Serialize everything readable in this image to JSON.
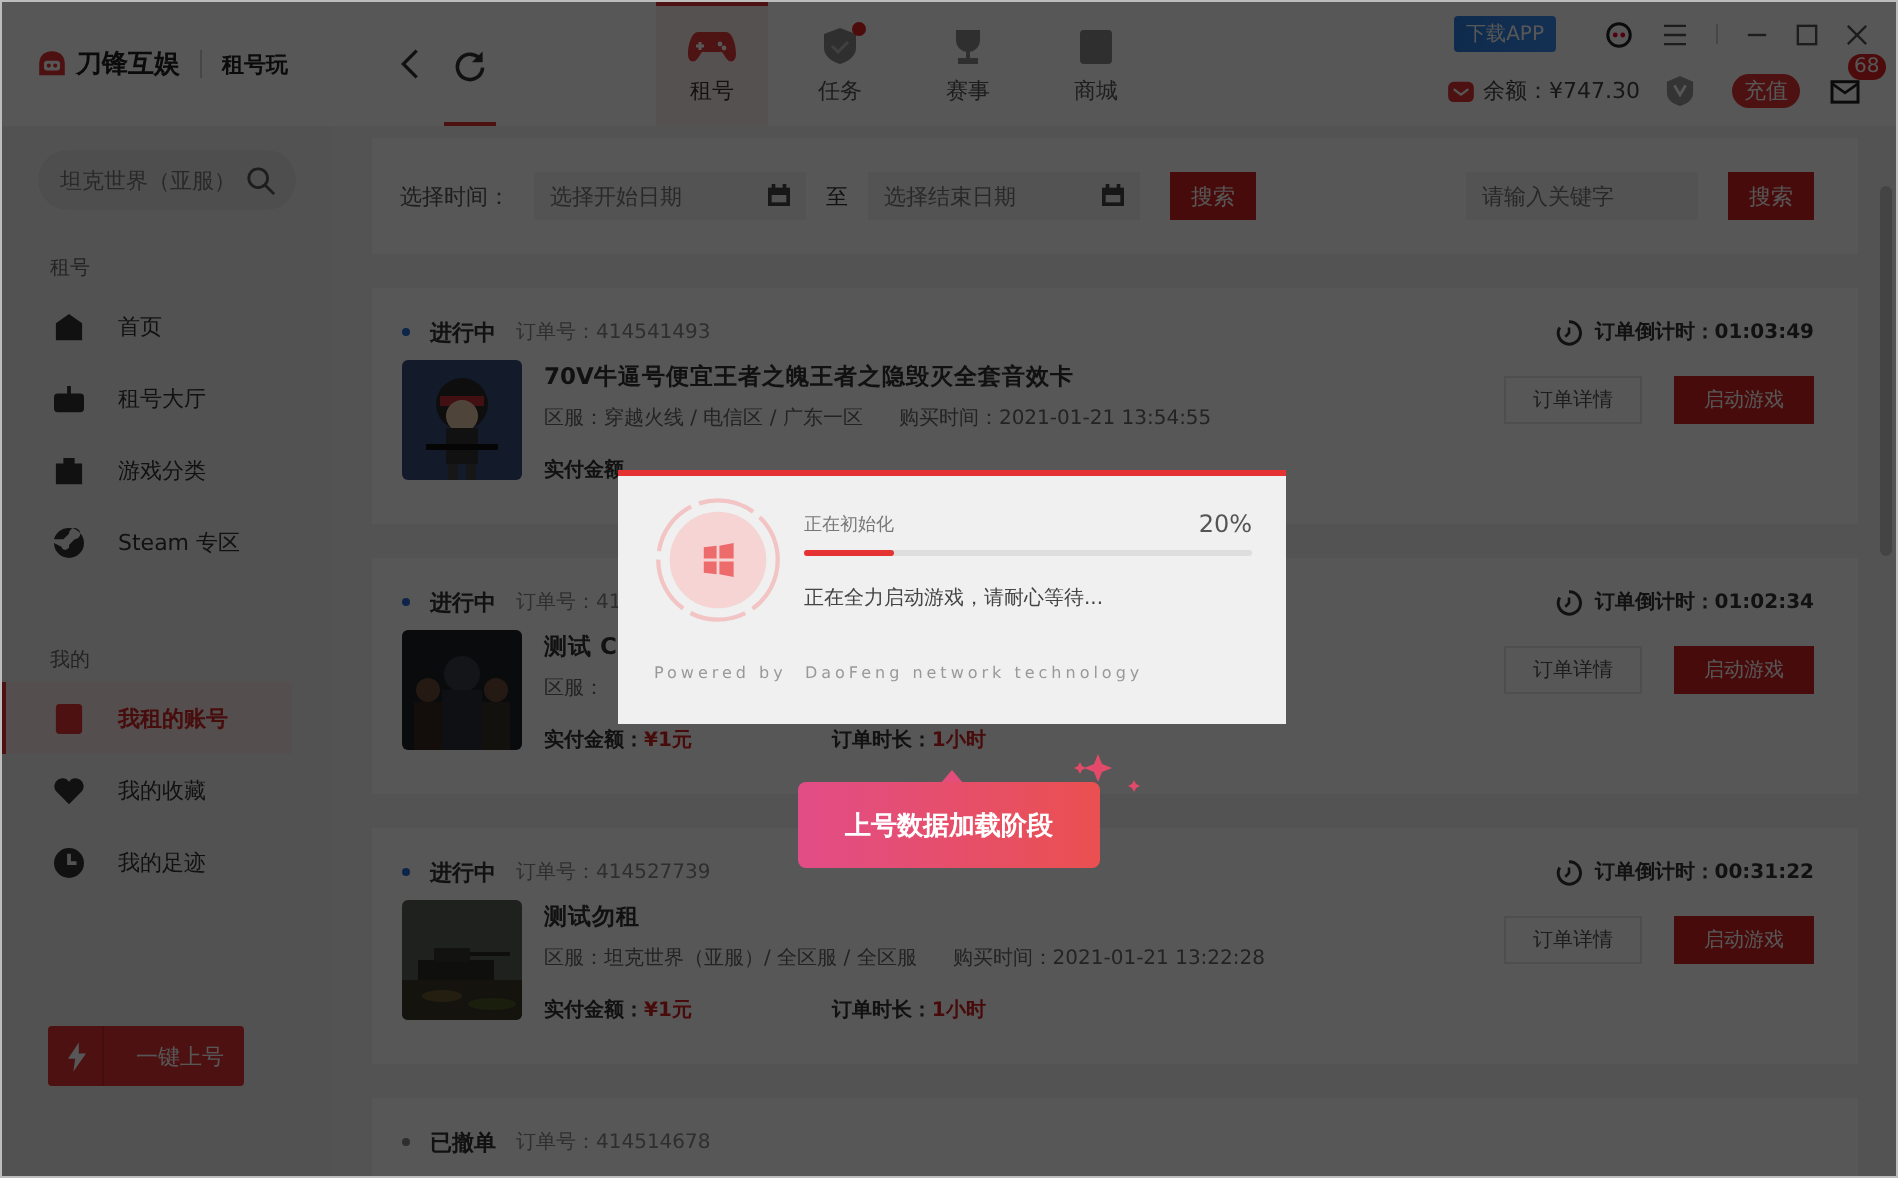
{
  "header": {
    "logo_text": "刀锋互娱",
    "sub_logo_text": "租号玩",
    "tabs": [
      {
        "label": "租号",
        "selected": true,
        "badge": false
      },
      {
        "label": "任务",
        "selected": false,
        "badge": true
      },
      {
        "label": "赛事",
        "selected": false,
        "badge": false
      },
      {
        "label": "商城",
        "selected": false,
        "badge": false
      }
    ],
    "download_label": "下载APP",
    "balance": "余额：¥747.30",
    "recharge": "充值",
    "mail_count": "68"
  },
  "sidebar": {
    "search_placeholder": "坦克世界（亚服）",
    "sections": [
      {
        "title": "租号",
        "items": [
          {
            "label": "首页",
            "selected": false
          },
          {
            "label": "租号大厅",
            "selected": false
          },
          {
            "label": "游戏分类",
            "selected": false
          },
          {
            "label": "Steam 专区",
            "selected": false
          }
        ]
      },
      {
        "title": "我的",
        "items": [
          {
            "label": "我租的账号",
            "selected": true
          },
          {
            "label": "我的收藏",
            "selected": false
          },
          {
            "label": "我的足迹",
            "selected": false
          }
        ]
      }
    ],
    "quick_button": "一键上号"
  },
  "filter": {
    "label": "选择时间：",
    "start_placeholder": "选择开始日期",
    "separator": "至",
    "end_placeholder": "选择结束日期",
    "search_button": "搜索",
    "keyword_placeholder": "请输入关键字",
    "keyword_button": "搜索"
  },
  "orders": [
    {
      "status": "进行中",
      "kind": "active",
      "order_no": "订单号：414541493",
      "countdown": "订单倒计时：01:03:49",
      "title": "70V牛逼号便宜王者之魄王者之隐毁灭全套音效卡",
      "region": "区服：穿越火线 / 电信区 / 广东一区",
      "purchase_time": "购买时间：2021-01-21 13:54:55",
      "paid_label": "实付金额",
      "buttons": [
        "订单详情",
        "启动游戏"
      ]
    },
    {
      "status": "进行中",
      "kind": "active",
      "order_no": "订单号：41",
      "countdown": "订单倒计时：01:02:34",
      "title": "测试 C",
      "region": "区服：",
      "paid_label": "实付金额：",
      "paid": "¥1元",
      "duration_label": "订单时长：",
      "duration": "1小时",
      "buttons": [
        "订单详情",
        "启动游戏"
      ]
    },
    {
      "status": "进行中",
      "kind": "active",
      "order_no": "订单号：414527739",
      "countdown": "订单倒计时：00:31:22",
      "title": "测试勿租",
      "region": "区服：坦克世界（亚服）/ 全区服 / 全区服",
      "purchase_time": "购买时间：2021-01-21 13:22:28",
      "paid_label": "实付金额：",
      "paid": "¥1元",
      "duration_label": "订单时长：",
      "duration": "1小时",
      "buttons": [
        "订单详情",
        "启动游戏"
      ]
    },
    {
      "status": "已撤单",
      "kind": "cancelled",
      "order_no": "订单号：414514678"
    }
  ],
  "dialog": {
    "status": "正在初始化",
    "percent": "20%",
    "level": 0.2,
    "message": "正在全力启动游戏，请耐心等待...",
    "footer": "Powered by  DaoFeng network technology"
  },
  "tooltip": "上号数据加载阶段"
}
